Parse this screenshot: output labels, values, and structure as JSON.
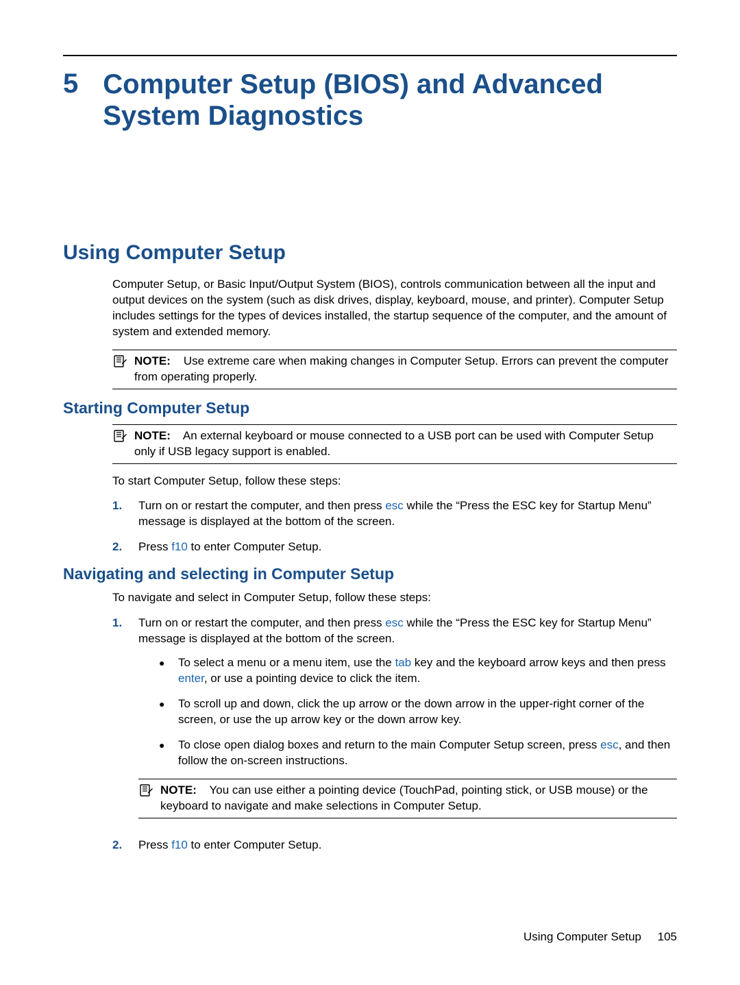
{
  "chapter": {
    "number": "5",
    "title": "Computer Setup (BIOS) and Advanced System Diagnostics"
  },
  "section1": {
    "heading": "Using Computer Setup",
    "intro": "Computer Setup, or Basic Input/Output System (BIOS), controls communication between all the input and output devices on the system (such as disk drives, display, keyboard, mouse, and printer). Computer Setup includes settings for the types of devices installed, the startup sequence of the computer, and the amount of system and extended memory.",
    "note1": {
      "label": "NOTE:",
      "text": "Use extreme care when making changes in Computer Setup. Errors can prevent the computer from operating properly."
    }
  },
  "section2": {
    "heading": "Starting Computer Setup",
    "note": {
      "label": "NOTE:",
      "text": "An external keyboard or mouse connected to a USB port can be used with Computer Setup only if USB legacy support is enabled."
    },
    "intro": "To start Computer Setup, follow these steps:",
    "steps": [
      {
        "num": "1.",
        "pre": "Turn on or restart the computer, and then press ",
        "key": "esc",
        "post": " while the “Press the ESC key for Startup Menu” message is displayed at the bottom of the screen."
      },
      {
        "num": "2.",
        "pre": "Press ",
        "key": "f10",
        "post": " to enter Computer Setup."
      }
    ]
  },
  "section3": {
    "heading": "Navigating and selecting in Computer Setup",
    "intro": "To navigate and select in Computer Setup, follow these steps:",
    "step1": {
      "num": "1.",
      "pre": "Turn on or restart the computer, and then press ",
      "key": "esc",
      "post": " while the “Press the ESC key for Startup Menu” message is displayed at the bottom of the screen."
    },
    "bullets": [
      {
        "pre": "To select a menu or a menu item, use the ",
        "key1": "tab",
        "mid": " key and the keyboard arrow keys and then press ",
        "key2": "enter",
        "post": ", or use a pointing device to click the item."
      },
      {
        "text": "To scroll up and down, click the up arrow or the down arrow in the upper-right corner of the screen, or use the up arrow key or the down arrow key."
      },
      {
        "pre": "To close open dialog boxes and return to the main Computer Setup screen, press ",
        "key1": "esc",
        "post": ", and then follow the on-screen instructions."
      }
    ],
    "note": {
      "label": "NOTE:",
      "text": "You can use either a pointing device (TouchPad, pointing stick, or USB mouse) or the keyboard to navigate and make selections in Computer Setup."
    },
    "step2": {
      "num": "2.",
      "pre": "Press ",
      "key": "f10",
      "post": " to enter Computer Setup."
    }
  },
  "footer": {
    "section": "Using Computer Setup",
    "page": "105"
  }
}
